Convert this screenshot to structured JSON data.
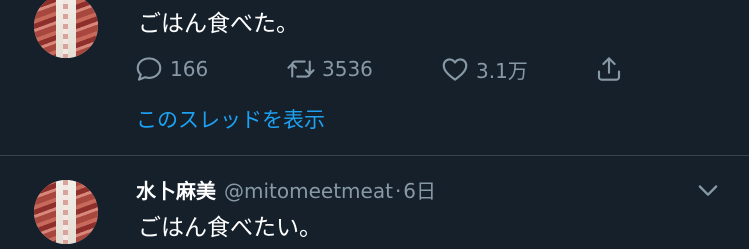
{
  "tweets": [
    {
      "text": "ごはん食べた。",
      "stats": {
        "replies": "166",
        "retweets": "3536",
        "likes": "3.1万"
      },
      "thread_link": "このスレッドを表示"
    },
    {
      "display_name": "水卜麻美",
      "handle": "@mitomeetmeat",
      "separator": "·",
      "time": "6日",
      "text": "ごはん食べたい。"
    }
  ],
  "icons": {
    "reply": "reply-icon",
    "retweet": "retweet-icon",
    "like": "like-icon",
    "share": "share-icon",
    "more": "chevron-down-icon"
  },
  "colors": {
    "background": "#15202b",
    "text": "#ffffff",
    "secondary_text": "#8899a6",
    "link": "#1da1f2",
    "divider": "#38444d"
  }
}
